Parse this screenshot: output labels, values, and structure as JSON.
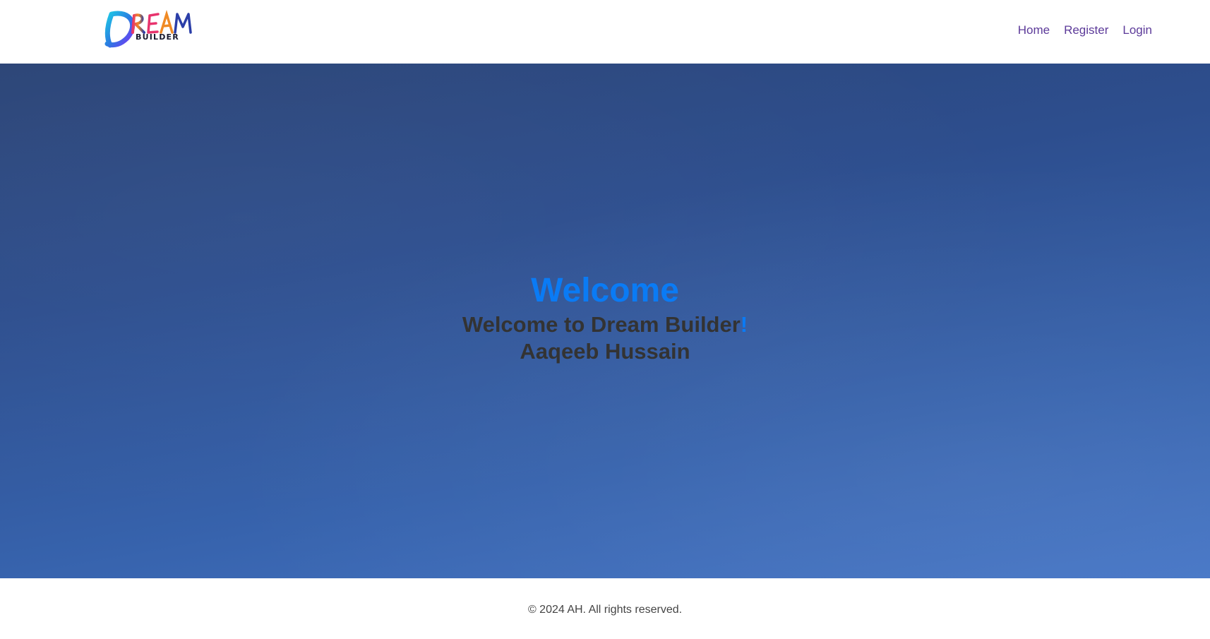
{
  "brand": {
    "logo_word": "DREAM",
    "logo_subword": "BUILDER"
  },
  "nav": {
    "items": [
      {
        "label": "Home"
      },
      {
        "label": "Register"
      },
      {
        "label": "Login"
      }
    ],
    "link_color": "#5c3a99"
  },
  "hero": {
    "title": "Welcome",
    "subtitle_main": "Welcome to Dream Builder",
    "subtitle_accent": "!",
    "user_name": "Aaqeeb Hussain",
    "accent_color": "#0a7bf5"
  },
  "footer": {
    "copyright": "© 2024 AH. All rights reserved."
  }
}
